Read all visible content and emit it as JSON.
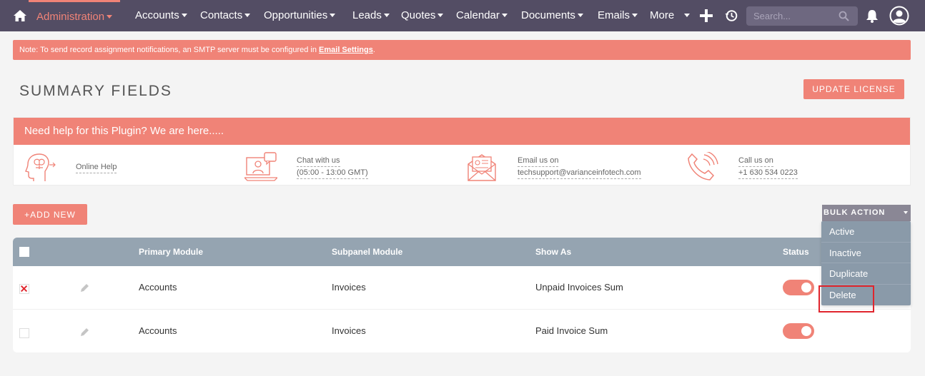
{
  "nav": {
    "items": [
      {
        "label": "Administration",
        "active": true
      },
      {
        "label": "Accounts"
      },
      {
        "label": "Contacts"
      },
      {
        "label": "Opportunities"
      },
      {
        "label": "Leads"
      },
      {
        "label": "Quotes"
      },
      {
        "label": "Calendar"
      },
      {
        "label": "Documents"
      },
      {
        "label": "Emails"
      },
      {
        "label": "More"
      }
    ],
    "search_placeholder": "Search...",
    "icons": [
      "home-icon",
      "plus-icon",
      "history-icon",
      "search-icon",
      "bell-icon",
      "user-icon"
    ]
  },
  "notice": {
    "text": "Note: To send record assignment notifications, an SMTP server must be configured in ",
    "link": "Email Settings",
    "suffix": "."
  },
  "page": {
    "title": "SUMMARY FIELDS",
    "update_label": "UPDATE LICENSE",
    "add_label": "+ADD NEW"
  },
  "help": {
    "header": "Need help for this Plugin? We are here.....",
    "items": [
      {
        "icon": "brain-icon",
        "lines": [
          "Online Help"
        ]
      },
      {
        "icon": "chat-icon",
        "lines": [
          "Chat with us",
          "(05:00 - 13:00 GMT)"
        ]
      },
      {
        "icon": "email-icon",
        "lines": [
          "Email us on",
          "techsupport@varianceinfotech.com"
        ]
      },
      {
        "icon": "phone-icon",
        "lines": [
          "Call us on",
          "+1 630 534 0223"
        ]
      }
    ]
  },
  "bulk": {
    "label": "BULK ACTION",
    "options": [
      "Active",
      "Inactive",
      "Duplicate",
      "Delete"
    ]
  },
  "table": {
    "headers": [
      "Primary Module",
      "Subpanel Module",
      "Show As",
      "Status"
    ],
    "rows": [
      {
        "primary": "Accounts",
        "subpanel": "Invoices",
        "show_as": "Unpaid Invoices Sum",
        "checked": true,
        "status": "on"
      },
      {
        "primary": "Accounts",
        "subpanel": "Invoices",
        "show_as": "Paid Invoice Sum",
        "checked": false,
        "status": "on"
      }
    ]
  },
  "colors": {
    "accent": "#f08377",
    "nav_bg": "#534d64",
    "table_head": "#95a4b1",
    "highlight": "#e0252d"
  }
}
